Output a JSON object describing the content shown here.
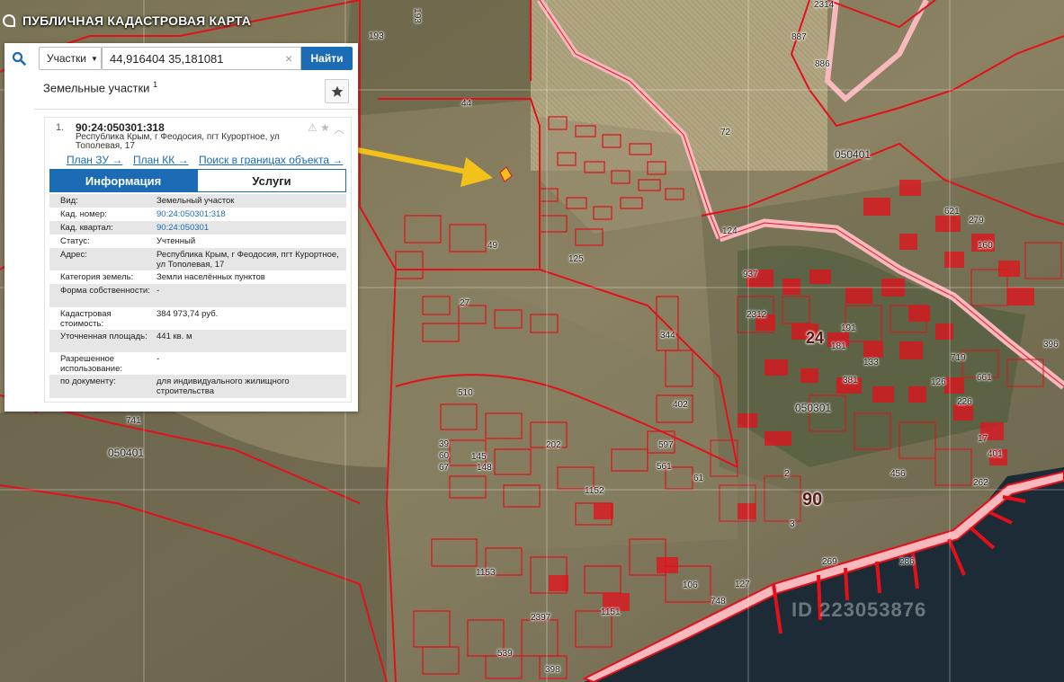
{
  "app": {
    "title": "ПУБЛИЧНАЯ КАДАСТРОВАЯ КАРТА"
  },
  "search": {
    "type_label": "Участки",
    "query_value": "44,916404 35,181081",
    "find_label": "Найти",
    "clear_symbol": "×"
  },
  "results": {
    "heading": "Земельные участки",
    "count": "1"
  },
  "card": {
    "index": "1.",
    "cad_number": "90:24:050301:318",
    "address": "Республика Крым, г Феодосия, пгт Курортное, ул Тополевая, 17",
    "links": [
      {
        "label": "План ЗУ →"
      },
      {
        "label": "План КК →"
      },
      {
        "label": "Поиск в границах объекта →"
      }
    ],
    "tabs": [
      {
        "label": "Информация"
      },
      {
        "label": "Услуги"
      }
    ],
    "rows": [
      {
        "key": "Вид:",
        "value": "Земельный участок"
      },
      {
        "key": "Кад. номер:",
        "value": "90:24:050301:318"
      },
      {
        "key": "Кад. квартал:",
        "value": "90:24:050301"
      },
      {
        "key": "Статус:",
        "value": "Учтенный"
      },
      {
        "key": "Адрес:",
        "value": "Республика Крым, г Феодосия, пгт Курортное, ул Тополевая, 17"
      },
      {
        "key": "Категория земель:",
        "value": "Земли населённых пунктов"
      },
      {
        "key": "Форма собственности:",
        "value": "-"
      },
      {
        "key": "Кадастровая стоимость:",
        "value": "384 973,74 руб."
      },
      {
        "key": "Уточненная площадь:",
        "value": "441 кв. м"
      },
      {
        "key": "Разрешенное использование:",
        "value": "-"
      },
      {
        "key": "по документу:",
        "value": "для индивидуального жилищного строительства"
      }
    ]
  },
  "map": {
    "labels": [
      "193",
      "193",
      "44",
      "72",
      "050401",
      "050401",
      "741",
      "27",
      "49",
      "125",
      "124",
      "937",
      "2312",
      "24",
      "381",
      "050301",
      "90",
      "456",
      "401",
      "269",
      "286",
      "127",
      "748",
      "1152",
      "1153",
      "1151",
      "2397",
      "398",
      "597",
      "561",
      "61",
      "402",
      "344",
      "510",
      "202",
      "145",
      "148",
      "39",
      "60",
      "67",
      "621",
      "279",
      "160",
      "396",
      "719",
      "661",
      "262",
      "17",
      "226",
      "2314",
      "887",
      "886",
      "126",
      "191",
      "2",
      "3",
      "106",
      "539",
      "133",
      "181"
    ],
    "watermark": "ID 223053876",
    "colors": {
      "parcel_stroke": "#e3101a",
      "road_fill": "#f7b9bd",
      "arrow": "#f2c21a",
      "sea": "#1c2b36"
    }
  }
}
